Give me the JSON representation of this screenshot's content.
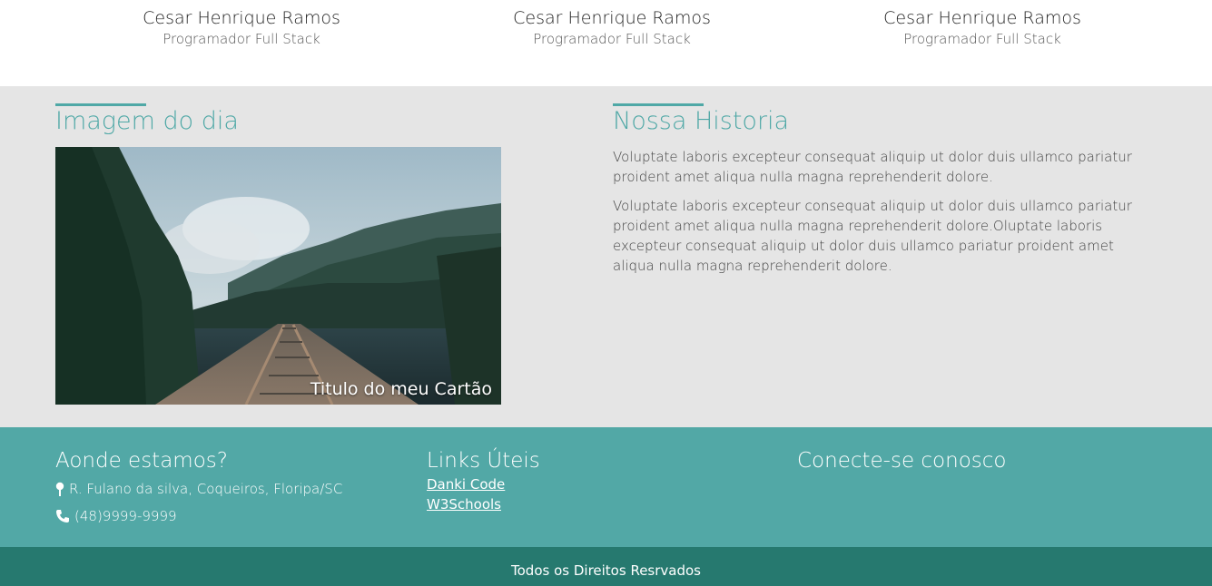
{
  "team": [
    {
      "name": "Cesar Henrique Ramos",
      "role": "Programador Full Stack"
    },
    {
      "name": "Cesar Henrique Ramos",
      "role": "Programador Full Stack"
    },
    {
      "name": "Cesar Henrique Ramos",
      "role": "Programador Full Stack"
    }
  ],
  "image_of_day": {
    "title": "Imagem do dia",
    "caption": "Titulo do meu Cartão"
  },
  "history": {
    "title": "Nossa Historia",
    "paragraphs": [
      "Voluptate laboris excepteur consequat aliquip ut dolor duis ullamco pariatur proident amet aliqua nulla magna reprehenderit dolore.",
      "Voluptate laboris excepteur consequat aliquip ut dolor duis ullamco pariatur proident amet aliqua nulla magna reprehenderit dolore.Oluptate laboris excepteur consequat aliquip ut dolor duis ullamco pariatur proident amet aliqua nulla magna reprehenderit dolore."
    ]
  },
  "footer": {
    "location": {
      "title": "Aonde estamos?",
      "address": "R. Fulano da silva, Coqueiros, Floripa/SC",
      "phone": "(48)9999-9999"
    },
    "links": {
      "title": "Links Úteis",
      "items": [
        "Danki Code",
        "W3Schools"
      ]
    },
    "connect": {
      "title": "Conecte-se conosco"
    }
  },
  "copyright": "Todos os Direitos Resrvados",
  "colors": {
    "accent": "#4fa8a6",
    "footer": "#52a8a6",
    "bottom_bar": "#26796f",
    "section_gray": "#e5e5e5"
  },
  "icons": {
    "address": "map-pin-icon",
    "phone": "phone-icon"
  }
}
